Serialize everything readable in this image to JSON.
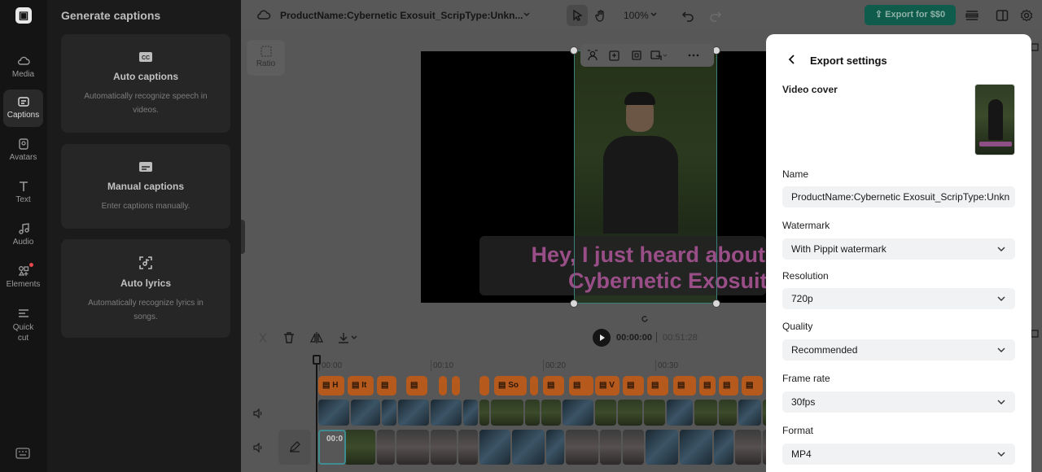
{
  "rail": {
    "items": [
      {
        "label": "Media",
        "icon": "cloud-upload-icon"
      },
      {
        "label": "Captions",
        "icon": "captions-icon"
      },
      {
        "label": "Avatars",
        "icon": "avatar-icon"
      },
      {
        "label": "Text",
        "icon": "text-icon"
      },
      {
        "label": "Audio",
        "icon": "music-note-icon"
      },
      {
        "label": "Elements",
        "icon": "elements-icon"
      },
      {
        "label": "Quick cut",
        "icon": "quick-cut-icon"
      }
    ],
    "active": "Captions"
  },
  "captions_panel": {
    "title": "Generate captions",
    "cards": [
      {
        "title": "Auto captions",
        "desc": "Automatically recognize speech in videos.",
        "icon": "cc-icon"
      },
      {
        "title": "Manual captions",
        "desc": "Enter captions manually.",
        "icon": "subtitle-icon"
      },
      {
        "title": "Auto lyrics",
        "desc": "Automatically recognize lyrics in songs.",
        "icon": "scan-lyrics-icon"
      }
    ]
  },
  "topbar": {
    "project_title": "ProductName:Cybernetic Exosuit_ScripType:Unkn...",
    "zoom": "100%",
    "export_label": "Export for $$0"
  },
  "canvas": {
    "ratio_label": "Ratio",
    "subtitle_line1": "Hey, I just heard about this",
    "subtitle_line2": "Cybernetic Exosuit."
  },
  "timeline": {
    "current_time": "00:00:00",
    "total_time": "00:51:28",
    "ruler": [
      "00:00",
      "00:10",
      "00:20",
      "00:30"
    ],
    "caption_clips": [
      "H",
      "It",
      "",
      "",
      "",
      "",
      "",
      "So",
      "",
      "",
      "",
      "V",
      "",
      "",
      "",
      "",
      "",
      "",
      "",
      ""
    ],
    "selected_clip_time": "00:0"
  },
  "export_modal": {
    "title": "Export settings",
    "video_cover_label": "Video cover",
    "name_label": "Name",
    "name_value": "ProductName:Cybernetic Exosuit_ScripType:Unkn",
    "watermark_label": "Watermark",
    "watermark_value": "With Pippit watermark",
    "resolution_label": "Resolution",
    "resolution_value": "720p",
    "quality_label": "Quality",
    "quality_value": "Recommended",
    "framerate_label": "Frame rate",
    "framerate_value": "30fps",
    "format_label": "Format",
    "format_value": "MP4"
  },
  "colors": {
    "export_button": "#0f5b4c",
    "caption_clip": "#b55a1c",
    "subtitle_text": "#9a4e88"
  }
}
